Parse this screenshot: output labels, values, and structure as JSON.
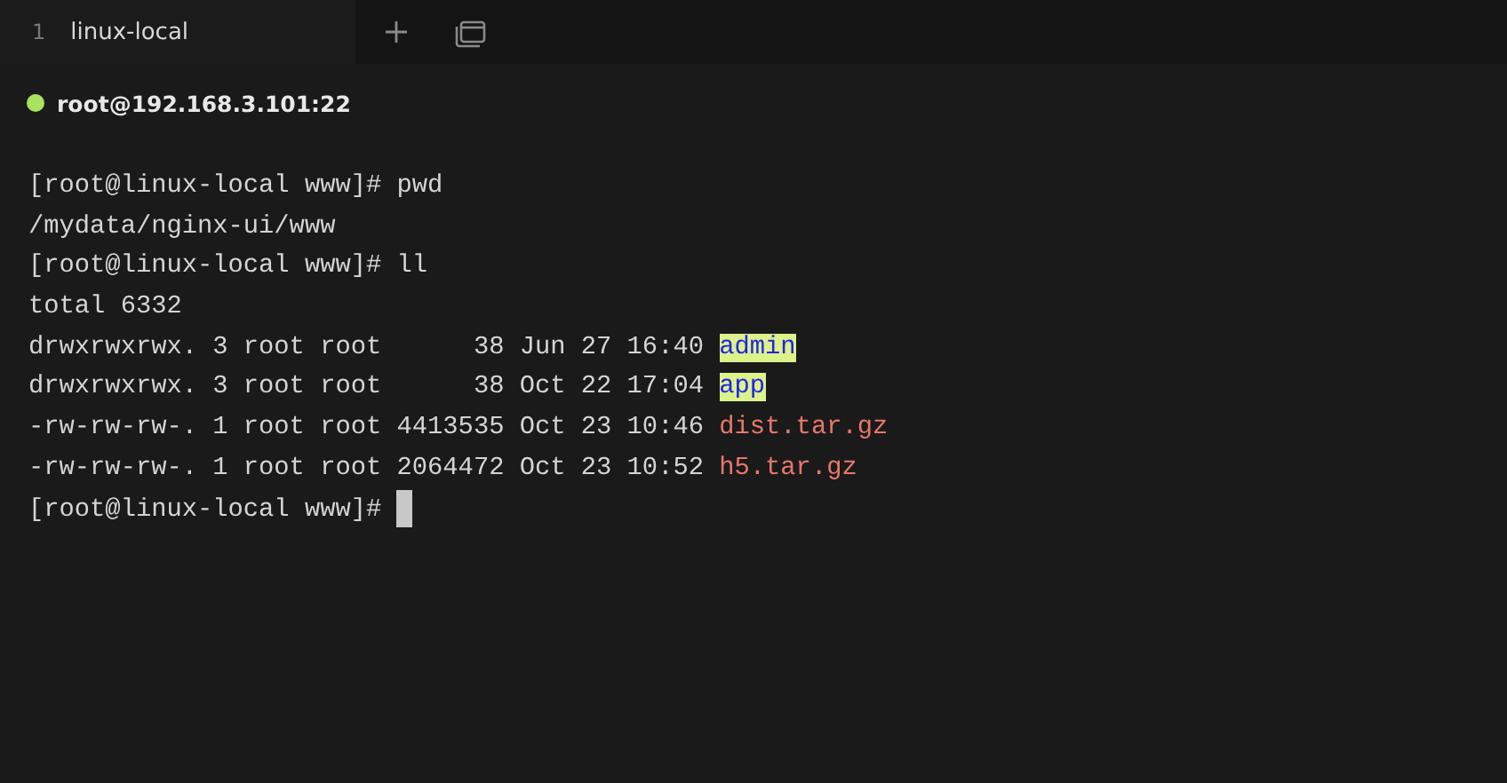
{
  "tabs": [
    {
      "number": "1",
      "label": "linux-local",
      "selected": true
    }
  ],
  "session": {
    "host": "root@192.168.3.101:22",
    "connected": true
  },
  "terminal": {
    "lines": [
      {
        "kind": "text",
        "text": "[root@linux-local www]# pwd"
      },
      {
        "kind": "text",
        "text": "/mydata/nginx-ui/www"
      },
      {
        "kind": "text",
        "text": "[root@linux-local www]# ll"
      },
      {
        "kind": "text",
        "text": "total 6332"
      },
      {
        "kind": "dir",
        "prefix": "drwxrwxrwx. 3 root root      38 Jun 27 16:40",
        "name": "admin"
      },
      {
        "kind": "dir",
        "prefix": "drwxrwxrwx. 3 root root      38 Oct 22 17:04",
        "name": "app"
      },
      {
        "kind": "archive",
        "prefix": "-rw-rw-rw-. 1 root root 4413535 Oct 23 10:46",
        "name": "dist.tar.gz"
      },
      {
        "kind": "archive",
        "prefix": "-rw-rw-rw-. 1 root root 2064472 Oct 23 10:52",
        "name": "h5.tar.gz"
      },
      {
        "kind": "prompt",
        "text": "[root@linux-local www]#",
        "cursor": true
      }
    ]
  }
}
